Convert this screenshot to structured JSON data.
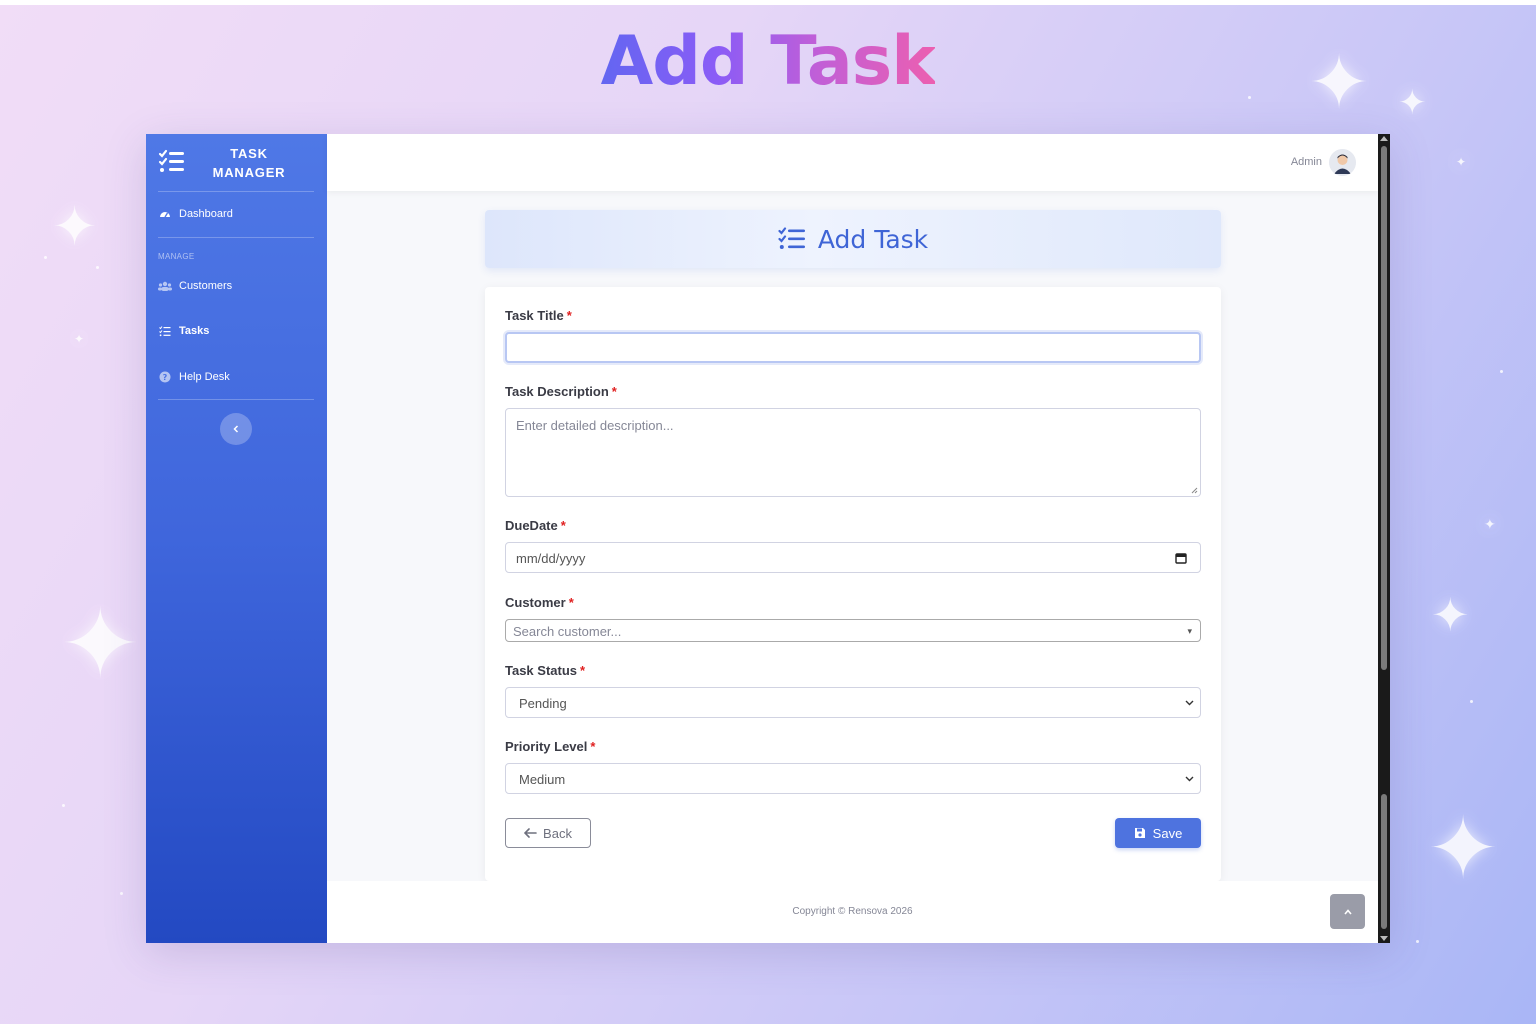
{
  "hero": {
    "title": "Add Task"
  },
  "sidebar": {
    "brand_line1": "TASK",
    "brand_line2": "MANAGER",
    "dashboard": "Dashboard",
    "heading": "MANAGE",
    "items": [
      {
        "label": "Customers",
        "icon": "users-icon"
      },
      {
        "label": "Tasks",
        "icon": "list-check-icon",
        "active": true
      },
      {
        "label": "Help Desk",
        "icon": "question-circle-icon"
      }
    ]
  },
  "topbar": {
    "user": "Admin"
  },
  "page": {
    "title": "Add Task"
  },
  "form": {
    "task_title": {
      "label": "Task Title",
      "value": ""
    },
    "description": {
      "label": "Task Description",
      "placeholder": "Enter detailed description..."
    },
    "due_date": {
      "label": "DueDate",
      "placeholder": "mm/dd/yyyy"
    },
    "customer": {
      "label": "Customer",
      "placeholder": "Search customer..."
    },
    "status": {
      "label": "Task Status",
      "value": "Pending"
    },
    "priority": {
      "label": "Priority Level",
      "value": "Medium"
    },
    "required_mark": "*",
    "back_label": "Back",
    "save_label": "Save"
  },
  "footer": {
    "text": "Copyright © Rensova 2026"
  },
  "colors": {
    "primary": "#4e73df",
    "sidebar_top": "#4f78e6",
    "sidebar_bottom": "#2349c2",
    "required": "#e02020"
  }
}
